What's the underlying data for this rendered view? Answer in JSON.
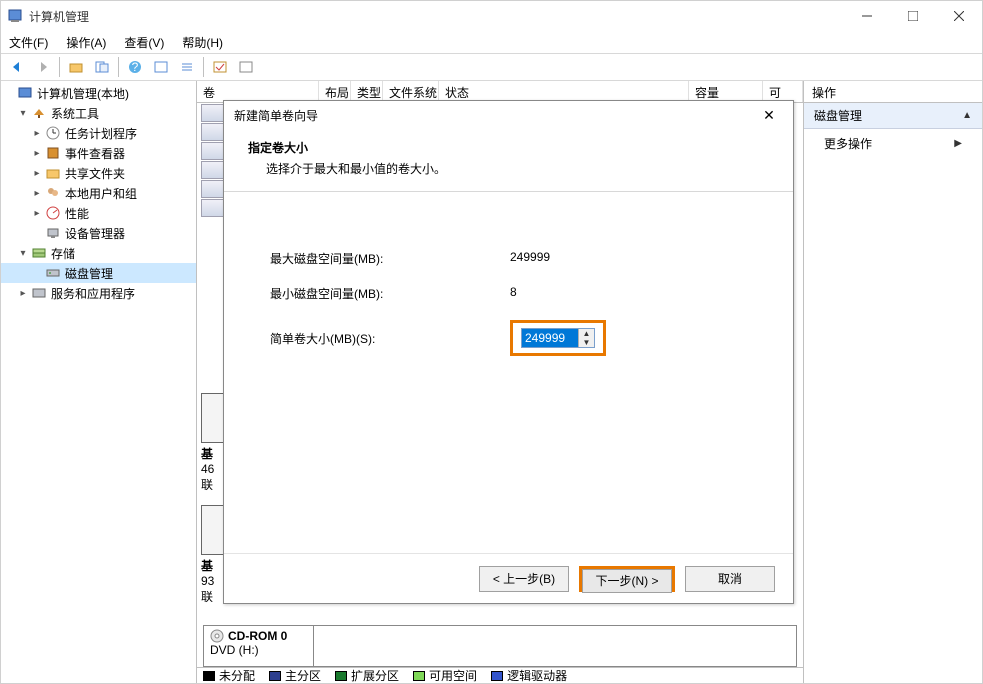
{
  "window": {
    "title": "计算机管理"
  },
  "menubar": {
    "file": "文件(F)",
    "action": "操作(A)",
    "view": "查看(V)",
    "help": "帮助(H)"
  },
  "tree": {
    "root": "计算机管理(本地)",
    "system_tools": "系统工具",
    "task_scheduler": "任务计划程序",
    "event_viewer": "事件查看器",
    "shared_folders": "共享文件夹",
    "local_users": "本地用户和组",
    "performance": "性能",
    "device_manager": "设备管理器",
    "storage": "存储",
    "disk_management": "磁盘管理",
    "services_apps": "服务和应用程序"
  },
  "list_header": {
    "volume": "卷",
    "layout": "布局",
    "type": "类型",
    "filesystem": "文件系统",
    "status": "状态",
    "capacity": "容量",
    "other": "可"
  },
  "disk_fragments": {
    "f1_l1": "基",
    "f1_l2": "46",
    "f1_l3": "联",
    "f2_l1": "基",
    "f2_l2": "93",
    "f2_l3": "联"
  },
  "cdrom": {
    "title": "CD-ROM 0",
    "sub": "DVD (H:)"
  },
  "legend": {
    "unallocated": "未分配",
    "primary": "主分区",
    "extended": "扩展分区",
    "free": "可用空间",
    "logical": "逻辑驱动器"
  },
  "legend_colors": {
    "unallocated": "#000000",
    "primary": "#2c3e8f",
    "extended": "#1a7a2e",
    "free": "#7fd858",
    "logical": "#3355cc"
  },
  "actions": {
    "header": "操作",
    "section": "磁盘管理",
    "more": "更多操作"
  },
  "dialog": {
    "title": "新建简单卷向导",
    "heading": "指定卷大小",
    "subheading": "选择介于最大和最小值的卷大小。",
    "max_label": "最大磁盘空间量(MB):",
    "max_value": "249999",
    "min_label": "最小磁盘空间量(MB):",
    "min_value": "8",
    "size_label": "简单卷大小(MB)(S):",
    "size_value": "249999",
    "back": "< 上一步(B)",
    "next": "下一步(N) >",
    "cancel": "取消"
  }
}
